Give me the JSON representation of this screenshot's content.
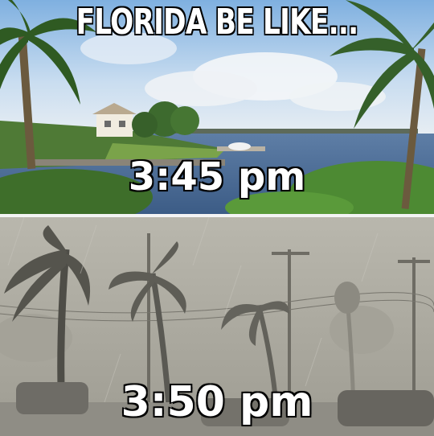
{
  "meme": {
    "title": "FLORIDA BE LIKE...",
    "before_caption": "3:45 pm",
    "after_caption": "3:50 pm"
  },
  "colors": {
    "caption_fill": "#ffffff",
    "caption_outline": "#000000",
    "divider": "#f4f4f4"
  }
}
